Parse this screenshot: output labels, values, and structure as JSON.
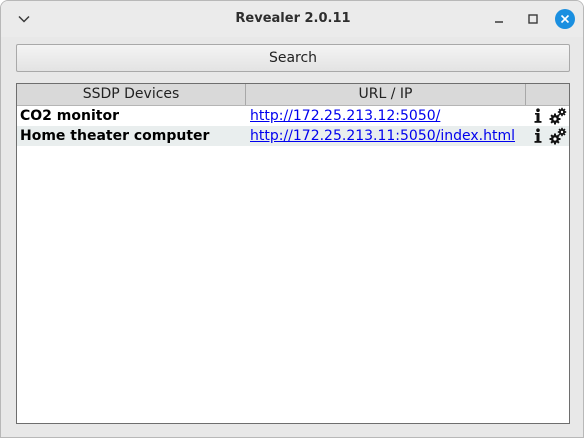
{
  "window": {
    "title": "Revealer 2.0.11",
    "icons": {
      "menu": "chevron-down-icon",
      "minimize": "minimize-icon",
      "maximize": "maximize-icon",
      "close": "close-icon"
    },
    "accent_color": "#1a8fe0"
  },
  "toolbar": {
    "search_label": "Search"
  },
  "table": {
    "columns": [
      "SSDP Devices",
      "URL / IP",
      ""
    ],
    "rows": [
      {
        "name": "CO2 monitor",
        "url": "http://172.25.213.12:5050/",
        "actions": [
          "info-icon",
          "gear-icon"
        ]
      },
      {
        "name": "Home theater computer",
        "url": "http://172.25.213.11:5050/index.html",
        "actions": [
          "info-icon",
          "gear-icon"
        ]
      }
    ],
    "link_color": "#0000ee",
    "alt_row_color": "#e9eeee"
  }
}
